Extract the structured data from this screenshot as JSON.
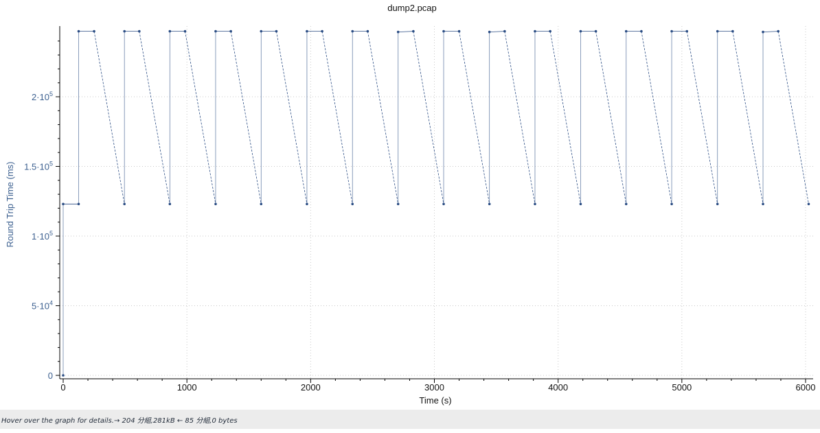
{
  "status_text": "Hover over the graph for details.→ 204 分組,281kB ← 85 分組,0 bytes",
  "colors": {
    "series": "#2b4d84",
    "axis_label": "#3b5f8f",
    "grid": "#c8c8c8",
    "status_bg": "#ececec"
  },
  "chart_data": {
    "type": "line",
    "title": "dump2.pcap",
    "xlabel": "Time (s)",
    "ylabel": "Round Trip Time (ms)",
    "xlim": [
      0,
      6050
    ],
    "ylim": [
      -2000,
      250000
    ],
    "x_ticks": [
      0,
      1000,
      2000,
      3000,
      4000,
      5000,
      6000
    ],
    "x_tick_labels": [
      "0",
      "1000",
      "2000",
      "3000",
      "4000",
      "5000",
      "6000"
    ],
    "y_ticks": [
      0,
      50000,
      100000,
      150000,
      200000
    ],
    "y_tick_labels": [
      {
        "mantissa": "0",
        "exponent": ""
      },
      {
        "mantissa": "5·10",
        "exponent": "4"
      },
      {
        "mantissa": "1·10",
        "exponent": "5"
      },
      {
        "mantissa": "1.5·10",
        "exponent": "5"
      },
      {
        "mantissa": "2·10",
        "exponent": "5"
      }
    ],
    "grid": true,
    "series": [
      {
        "points": [
          [
            0,
            0
          ],
          [
            0,
            123000
          ],
          [
            125,
            123000
          ],
          [
            125,
            247000
          ],
          [
            250,
            247000
          ],
          [
            495,
            123000
          ],
          [
            495,
            247000
          ],
          [
            615,
            247000
          ],
          [
            862,
            123000
          ],
          [
            862,
            247000
          ],
          [
            985,
            247000
          ],
          [
            1232,
            123000
          ],
          [
            1232,
            247000
          ],
          [
            1355,
            247000
          ],
          [
            1600,
            123000
          ],
          [
            1600,
            247000
          ],
          [
            1723,
            247000
          ],
          [
            1970,
            123000
          ],
          [
            1970,
            247000
          ],
          [
            2093,
            247000
          ],
          [
            2338,
            123000
          ],
          [
            2338,
            247000
          ],
          [
            2461,
            247000
          ],
          [
            2707,
            123000
          ],
          [
            2707,
            246500
          ],
          [
            2830,
            247000
          ],
          [
            3075,
            123000
          ],
          [
            3075,
            247000
          ],
          [
            3200,
            247000
          ],
          [
            3445,
            123000
          ],
          [
            3445,
            246500
          ],
          [
            3568,
            247000
          ],
          [
            3813,
            123000
          ],
          [
            3813,
            247000
          ],
          [
            3936,
            247000
          ],
          [
            4182,
            123000
          ],
          [
            4182,
            247000
          ],
          [
            4305,
            247000
          ],
          [
            4550,
            123000
          ],
          [
            4550,
            247000
          ],
          [
            4673,
            247000
          ],
          [
            4918,
            123000
          ],
          [
            4918,
            247000
          ],
          [
            5041,
            247000
          ],
          [
            5288,
            123000
          ],
          [
            5288,
            247000
          ],
          [
            5411,
            247000
          ],
          [
            5656,
            123000
          ],
          [
            5656,
            246500
          ],
          [
            5779,
            247000
          ],
          [
            6025,
            123000
          ]
        ]
      }
    ]
  }
}
